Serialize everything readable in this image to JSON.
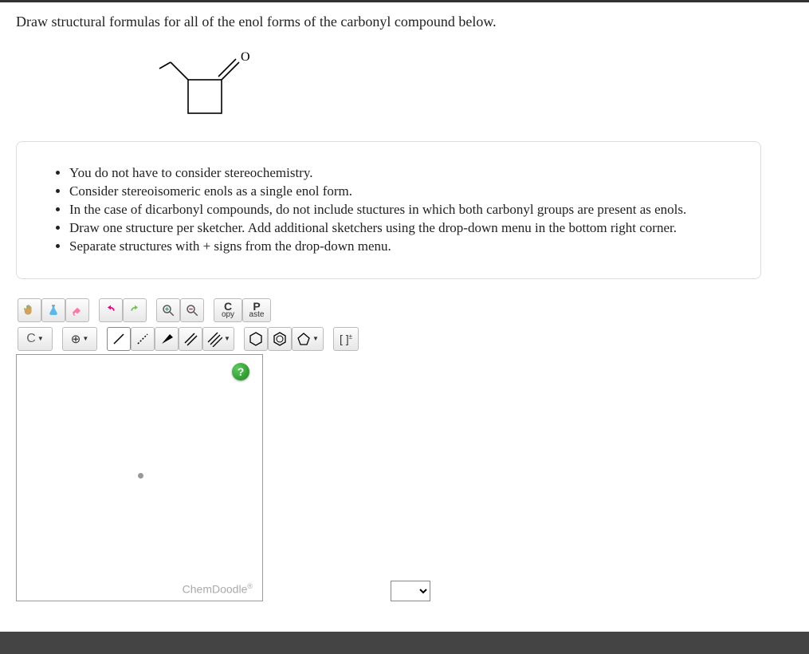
{
  "question": "Draw structural formulas for all of the enol forms of the carbonyl compound below.",
  "instructions": [
    "You do not have to consider stereochemistry.",
    "Consider stereoisomeric enols as a single enol form.",
    "In the case of dicarbonyl compounds, do not include stuctures in which both carbonyl groups are present as enols.",
    "Draw one structure per sketcher. Add additional sketchers using the drop-down menu in the bottom right corner.",
    "Separate structures with + signs from the drop-down menu."
  ],
  "toolbar1": {
    "copy_big": "C",
    "copy_small": "opy",
    "paste_big": "P",
    "paste_small": "aste"
  },
  "toolbar2": {
    "element": "C",
    "charge_label": "⊕"
  },
  "canvas": {
    "help_label": "?",
    "brand": "ChemDoodle"
  },
  "molecule_label": "O"
}
